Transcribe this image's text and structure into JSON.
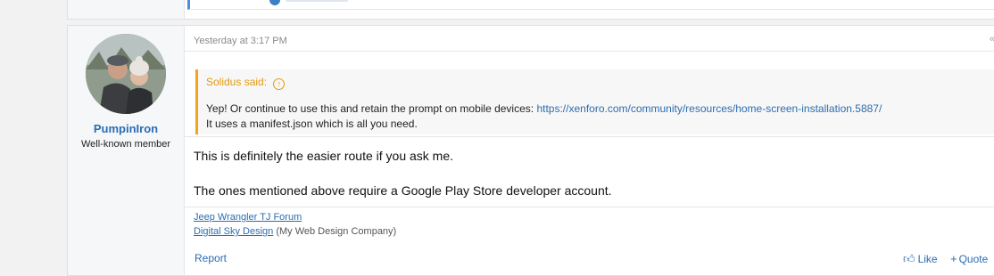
{
  "post": {
    "author": {
      "username": "PumpinIron",
      "title": "Well-known member"
    },
    "date": "Yesterday at 3:17 PM",
    "quote": {
      "header": "Solidus said:",
      "text_before_link": "Yep! Or continue to use this and retain the prompt on mobile devices: ",
      "link": "https://xenforo.com/community/resources/home-screen-installation.5887/",
      "line2": "It uses a manifest.json which is all you need."
    },
    "message": {
      "line1": "This is definitely the easier route if you ask me.",
      "line2": "The ones mentioned above require a Google Play Store developer account."
    },
    "signature": {
      "link1": "Jeep Wrangler TJ Forum",
      "link2": "Digital Sky Design",
      "link2_suffix": " (My Web Design Company)"
    },
    "actions": {
      "report": "Report",
      "like": "Like",
      "quote": "Quote"
    },
    "corner_mark": "«"
  },
  "icons": {
    "like": "thumbs-up-icon",
    "quote": "plus-icon",
    "quote_header": "arrow-up-icon"
  },
  "colors": {
    "link": "#2b6db2",
    "quote_accent": "#f3a41b"
  }
}
